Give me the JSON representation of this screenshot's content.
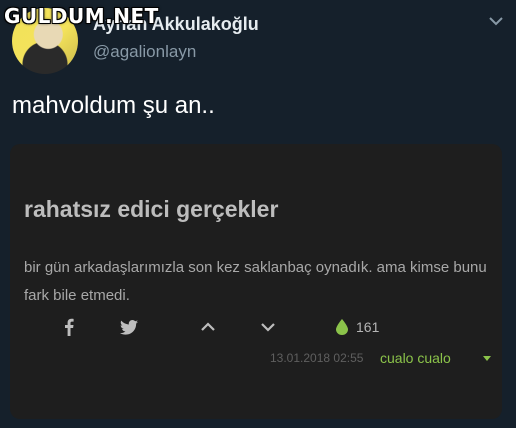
{
  "watermark": "GULDUM.NET",
  "author": {
    "name": "Ayhan Akkulakoğlu",
    "handle": "@agalionlayn"
  },
  "tweet": {
    "text": "mahvoldum şu an.."
  },
  "card": {
    "title": "rahatsız edici gerçekler",
    "body": "bir gün arkadaşlarımızla son kez saklanbaç oynadık. ama kimse bunu fark bile etmedi.",
    "like_count": "161",
    "date": "13.01.2018 02:55",
    "username": "cualo cualo",
    "icons": [
      "facebook-icon",
      "twitter-icon",
      "upvote-icon",
      "downvote-icon",
      "drop-icon",
      "dropdown-icon"
    ],
    "accent_color": "#8bc34a"
  },
  "colors": {
    "background": "#15202b",
    "card": "#1e1e1e"
  }
}
